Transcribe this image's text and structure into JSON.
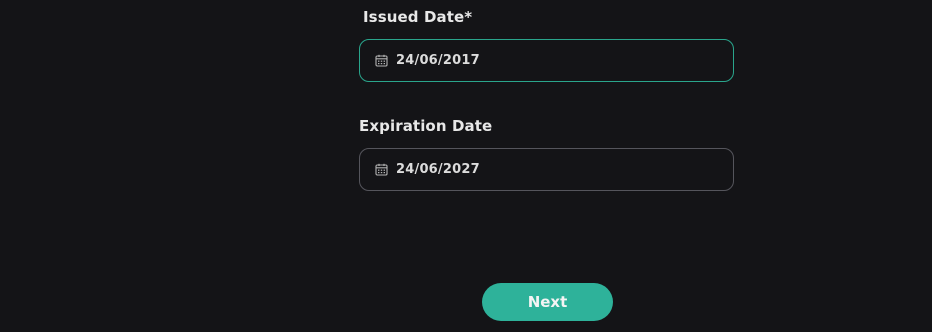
{
  "issued_date": {
    "label": "Issued Date*",
    "value": "24/06/2017",
    "icon": "calendar-icon"
  },
  "expiration_date": {
    "label": "Expiration Date",
    "value": "24/06/2027",
    "icon": "calendar-icon"
  },
  "next_button": {
    "label": "Next"
  },
  "colors": {
    "background": "#141417",
    "accent": "#2eb29a",
    "focus_border": "#2aa58c",
    "input_border": "#55555c"
  }
}
